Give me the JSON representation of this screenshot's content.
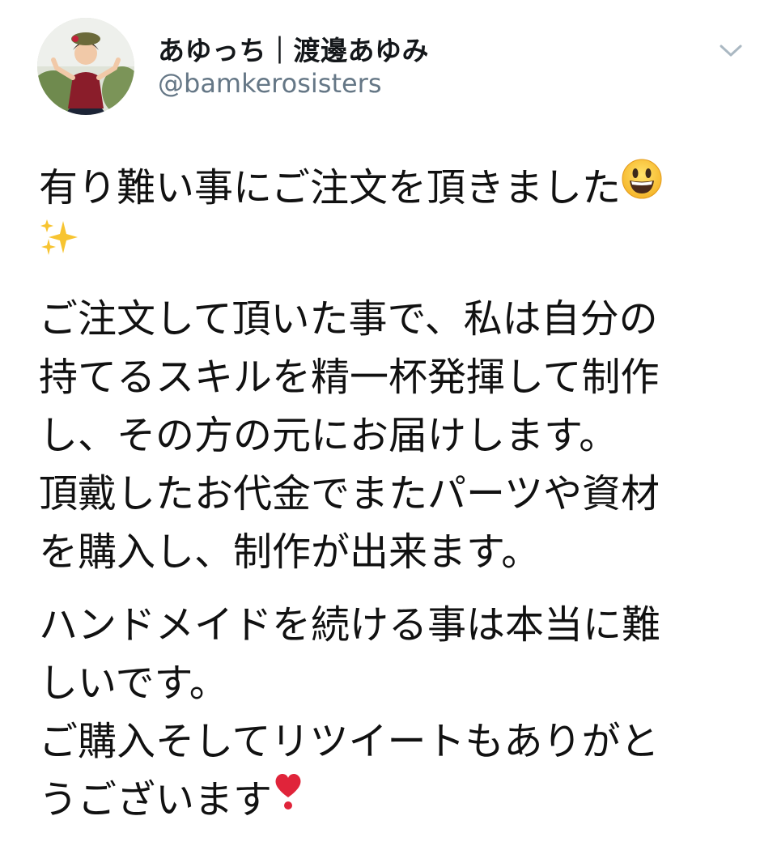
{
  "user": {
    "display_name": "あゆっち｜渡邊あゆみ",
    "handle": "@bamkerosisters"
  },
  "icons": {
    "avatar": "profile-photo",
    "menu": "chevron-down-icon",
    "emoji_1": "grinning-face-emoji",
    "emoji_2": "sparkles-emoji",
    "emoji_3": "red-heart-exclamation-emoji"
  },
  "tweet": {
    "p1": {
      "line1": "有り難い事にご注文を頂きました"
    },
    "p2": {
      "line1": "ご注文して頂いた事で、私は自分の",
      "line2": "持てるスキルを精一杯発揮して制作",
      "line3": "し、その方の元にお届けします。",
      "line4": "頂戴したお代金でまたパーツや資材",
      "line5": "を購入し、制作が出来ます。"
    },
    "p3": {
      "line1": "ハンドメイドを続ける事は本当に難",
      "line2": "しいです。",
      "line3": "ご購入そしてリツイートもありがと",
      "line4": "うございます"
    }
  },
  "colors": {
    "name": "#14171a",
    "handle": "#657786",
    "body_text": "#111111",
    "background": "#ffffff"
  }
}
